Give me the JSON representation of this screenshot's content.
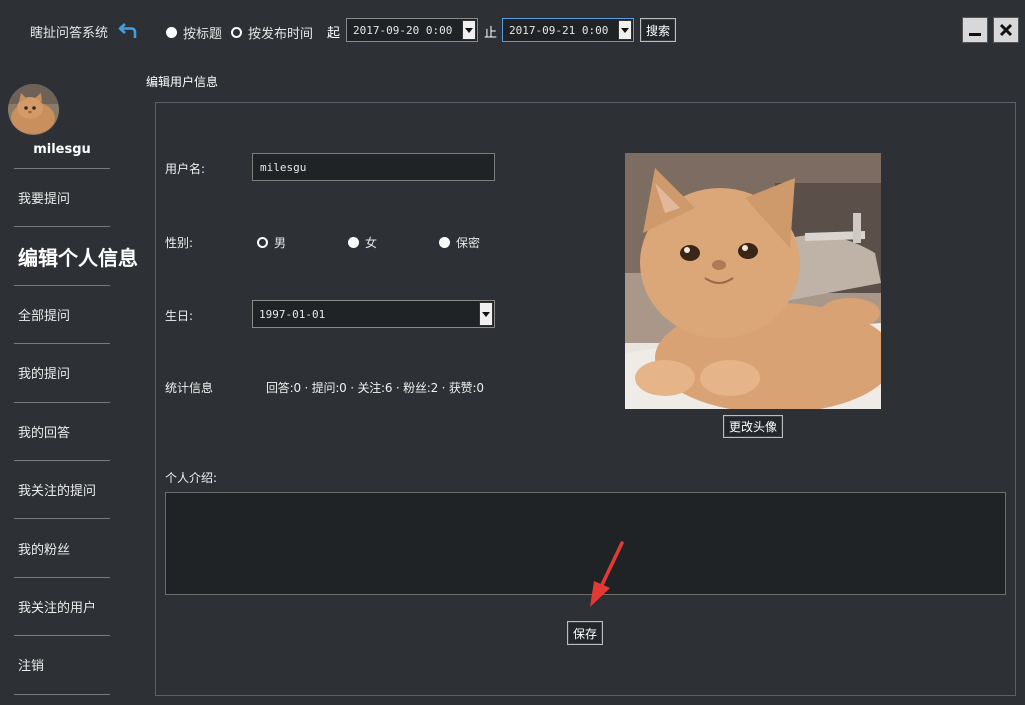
{
  "header": {
    "app_title": "瞎扯问答系统",
    "search_mode_options": [
      {
        "label": "按标题",
        "selected": false
      },
      {
        "label": "按发布时间",
        "selected": true
      }
    ],
    "from_label": "起",
    "from_date": "2017-09-20 0:00",
    "to_label": "止",
    "to_date": "2017-09-21 0:00",
    "search_button": "搜索"
  },
  "sidebar": {
    "username": "milesgu",
    "items": [
      {
        "label": "我要提问"
      },
      {
        "label": "编辑个人信息",
        "current": true
      },
      {
        "label": "全部提问"
      },
      {
        "label": "我的提问"
      },
      {
        "label": "我的回答"
      },
      {
        "label": "我关注的提问"
      },
      {
        "label": "我的粉丝"
      },
      {
        "label": "我关注的用户"
      },
      {
        "label": "注销"
      }
    ]
  },
  "main": {
    "section_title": "编辑用户信息",
    "username_label": "用户名:",
    "username_value": "milesgu",
    "gender_label": "性别:",
    "gender_options": [
      {
        "label": "男",
        "selected": true
      },
      {
        "label": "女",
        "selected": false
      },
      {
        "label": "保密",
        "selected": false
      }
    ],
    "birthday_label": "生日:",
    "birthday_value": "1997-01-01",
    "stats_label": "统计信息",
    "stats_value": "回答:0 · 提问:0 · 关注:6 · 粉丝:2 · 获赞:0",
    "change_avatar_button": "更改头像",
    "bio_label": "个人介绍:",
    "bio_value": "",
    "save_button": "保存"
  },
  "colors": {
    "background": "#2d3034",
    "input_background": "#202326",
    "annotation_arrow": "#e53935"
  }
}
